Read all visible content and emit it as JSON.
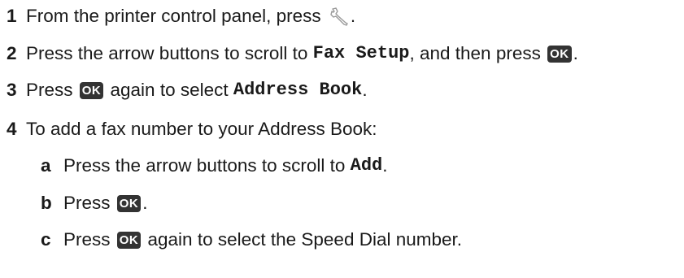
{
  "steps": [
    {
      "number": "1",
      "text_before": "From the printer control panel, press ",
      "icon": "wrench-icon",
      "text_after": "."
    },
    {
      "number": "2",
      "text_before": "Press the arrow buttons to scroll to ",
      "code": "Fax Setup",
      "text_middle": ", and then press ",
      "button": "OK",
      "text_after": "."
    },
    {
      "number": "3",
      "text_before": "Press ",
      "button": "OK",
      "text_middle": " again to select ",
      "code": "Address Book",
      "text_after": "."
    },
    {
      "number": "4",
      "text": "To add a fax number to your Address Book:"
    }
  ],
  "substeps": [
    {
      "letter": "a",
      "text_before": "Press the arrow buttons to scroll to ",
      "code": "Add",
      "text_after": "."
    },
    {
      "letter": "b",
      "text_before": "Press ",
      "button": "OK",
      "text_after": "."
    },
    {
      "letter": "c",
      "text_before": "Press ",
      "button": "OK",
      "text_after": " again to select the Speed Dial number."
    }
  ]
}
